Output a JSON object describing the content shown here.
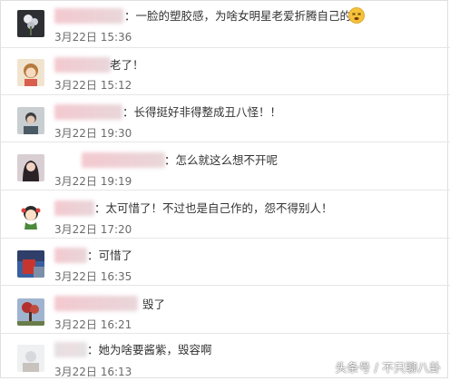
{
  "comments": [
    {
      "text": "：一脸的塑胶感，为啥女明星老爱折腾自己的脸",
      "time": "3月22日 15:36",
      "avatar_icon": "flower-photo-avatar",
      "emoji_icon": "dizzy-face-emoji"
    },
    {
      "text": "老了！",
      "time": "3月22日 15:12",
      "avatar_icon": "cartoon-girl-avatar"
    },
    {
      "text": "：长得挺好非得整成丑八怪！！",
      "time": "3月22日 19:30",
      "avatar_icon": "person-photo-avatar"
    },
    {
      "text": "：怎么就这么想不开呢",
      "time": "3月22日 19:19",
      "avatar_icon": "woman-photo-avatar"
    },
    {
      "text": "：太可惜了！不过也是自己作的，怨不得别人！",
      "time": "3月22日 17:20",
      "avatar_icon": "cartoon-kid-avatar"
    },
    {
      "text": "：可惜了",
      "time": "3月22日 16:35",
      "avatar_icon": "red-blue-photo-avatar"
    },
    {
      "text": "毁了",
      "time": "3月22日 16:21",
      "avatar_icon": "red-tree-avatar"
    },
    {
      "text": "：她为啥要酱紫，毁容啊",
      "time": "3月22日 16:13",
      "avatar_icon": "light-photo-avatar"
    }
  ],
  "watermark": "头条号 / 不只聊八卦"
}
